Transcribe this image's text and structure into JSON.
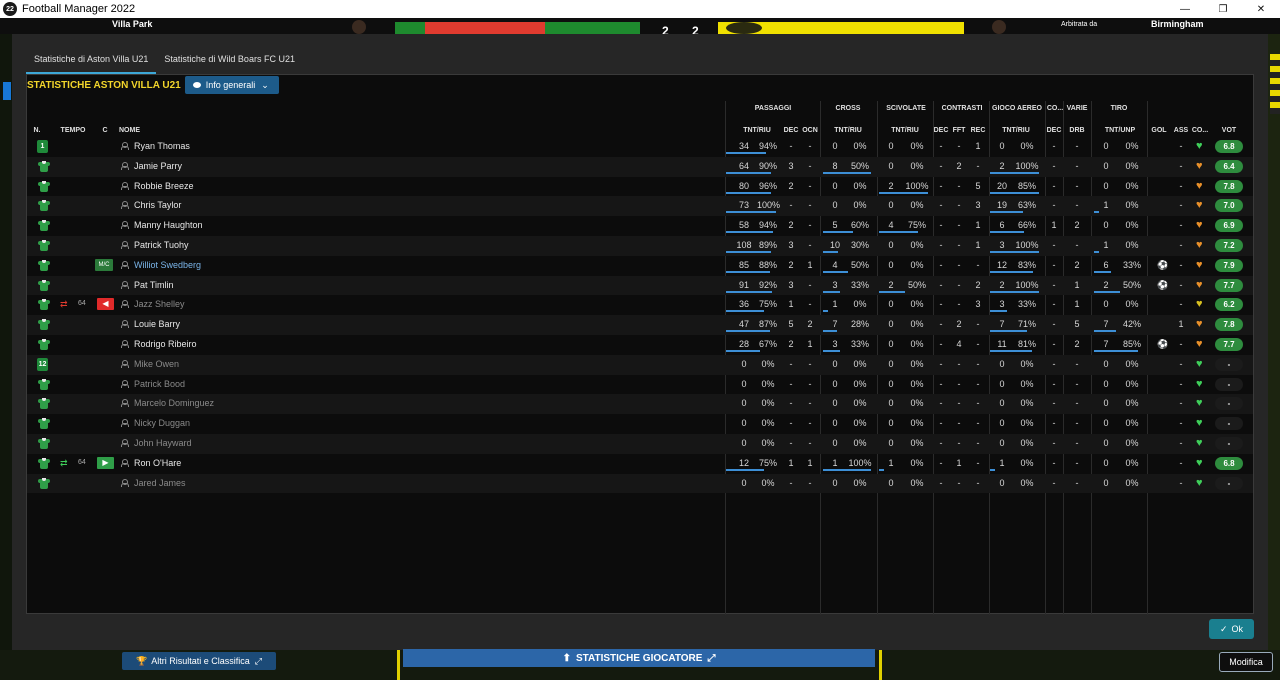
{
  "window": {
    "title": "Football Manager 2022",
    "app_badge": "22",
    "buttons": [
      "—",
      "❐",
      "✕"
    ]
  },
  "background": {
    "venue": "Villa Park",
    "score": "2 2",
    "referee_label": "Arbitrata da",
    "city": "Birmingham"
  },
  "tabs": [
    "Statistiche di Aston Villa U21",
    "Statistiche di Wild Boars FC U21"
  ],
  "panel": {
    "title": "STATISTICHE ASTON VILLA U21",
    "filter_label": "Info generali"
  },
  "groups": {
    "passaggi": "PASSAGGI",
    "cross": "CROSS",
    "scivolate": "SCIVOLATE",
    "contrasti": "CONTRASTI",
    "gioco_aereo": "GIOCO AEREO",
    "co": "CO...",
    "varie": "VARIE",
    "tiro": "TIRO"
  },
  "columns": {
    "n": "N.",
    "tempo": "TEMPO",
    "c": "C",
    "nome": "NOME",
    "pass_tntriu": "TNT/RIU",
    "dec": "DEC",
    "ocn": "OCN",
    "cross_tntriu": "TNT/RIU",
    "sciv_tntriu": "TNT/RIU",
    "contr_dec": "DEC",
    "contr_fft": "FFT",
    "contr_rec": "REC",
    "aereo_tntriu": "TNT/RIU",
    "co_dec": "DEC",
    "drb": "DRB",
    "tiro_tntunp": "TNT/UNP",
    "gol": "GOL",
    "ass": "ASS",
    "cond": "CO...",
    "vot": "VOT"
  },
  "rows": [
    {
      "num": "1",
      "name": "Ryan Thomas",
      "pass": [
        "34",
        "94%"
      ],
      "dec": "-",
      "ocn": "-",
      "cross": [
        "0",
        "0%"
      ],
      "sciv": [
        "0",
        "0%"
      ],
      "cdec": "-",
      "fft": "-",
      "rec": "1",
      "aereo": [
        "0",
        "0%"
      ],
      "adec": "-",
      "drb": "-",
      "tiro": [
        "0",
        "0%"
      ],
      "gol": "",
      "ass": "-",
      "vot": "6.8",
      "heart": "green",
      "pb": [
        0.8,
        0
      ],
      "cb": [
        0,
        0
      ],
      "sb": [
        0,
        0
      ],
      "ab": [
        0,
        0
      ],
      "tb": [
        0,
        0
      ]
    },
    {
      "num": "",
      "name": "Jamie Parry",
      "pass": [
        "64",
        "90%"
      ],
      "dec": "3",
      "ocn": "-",
      "cross": [
        "8",
        "50%"
      ],
      "sciv": [
        "0",
        "0%"
      ],
      "cdec": "-",
      "fft": "2",
      "rec": "-",
      "aereo": [
        "2",
        "100%"
      ],
      "adec": "-",
      "drb": "-",
      "tiro": [
        "0",
        "0%"
      ],
      "gol": "",
      "ass": "-",
      "vot": "6.4",
      "heart": "orange",
      "pb": [
        0.9,
        0
      ],
      "cb": [
        0.95,
        0
      ],
      "sb": [
        0,
        0
      ],
      "ab": [
        0.95,
        0
      ],
      "tb": [
        0,
        0
      ]
    },
    {
      "num": "",
      "name": "Robbie Breeze",
      "pass": [
        "80",
        "96%"
      ],
      "dec": "2",
      "ocn": "-",
      "cross": [
        "0",
        "0%"
      ],
      "sciv": [
        "2",
        "100%"
      ],
      "cdec": "-",
      "fft": "-",
      "rec": "5",
      "aereo": [
        "20",
        "85%"
      ],
      "adec": "-",
      "drb": "-",
      "tiro": [
        "0",
        "0%"
      ],
      "gol": "",
      "ass": "-",
      "vot": "7.8",
      "heart": "orange",
      "pb": [
        0.9,
        0
      ],
      "cb": [
        0,
        0
      ],
      "sb": [
        0.95,
        0
      ],
      "ab": [
        0.95,
        0
      ],
      "tb": [
        0,
        0
      ]
    },
    {
      "num": "",
      "name": "Chris Taylor",
      "pass": [
        "73",
        "100%"
      ],
      "dec": "-",
      "ocn": "-",
      "cross": [
        "0",
        "0%"
      ],
      "sciv": [
        "0",
        "0%"
      ],
      "cdec": "-",
      "fft": "-",
      "rec": "3",
      "aereo": [
        "19",
        "63%"
      ],
      "adec": "-",
      "drb": "-",
      "tiro": [
        "1",
        "0%"
      ],
      "gol": "",
      "ass": "-",
      "vot": "7.0",
      "heart": "orange",
      "pb": [
        1,
        0
      ],
      "cb": [
        0,
        0
      ],
      "sb": [
        0,
        0
      ],
      "ab": [
        0.63,
        0
      ],
      "tb": [
        0.1,
        0
      ]
    },
    {
      "num": "",
      "name": "Manny Haughton",
      "pass": [
        "58",
        "94%"
      ],
      "dec": "2",
      "ocn": "-",
      "cross": [
        "5",
        "60%"
      ],
      "sciv": [
        "4",
        "75%"
      ],
      "cdec": "-",
      "fft": "-",
      "rec": "1",
      "aereo": [
        "6",
        "66%"
      ],
      "adec": "1",
      "drb": "2",
      "tiro": [
        "0",
        "0%"
      ],
      "gol": "",
      "ass": "-",
      "vot": "6.9",
      "heart": "orange",
      "pb": [
        0.94,
        0
      ],
      "cb": [
        0.6,
        0
      ],
      "sb": [
        0.75,
        0
      ],
      "ab": [
        0.66,
        0
      ],
      "tb": [
        0,
        0
      ]
    },
    {
      "num": "",
      "name": "Patrick Tuohy",
      "pass": [
        "108",
        "89%"
      ],
      "dec": "3",
      "ocn": "-",
      "cross": [
        "10",
        "30%"
      ],
      "sciv": [
        "0",
        "0%"
      ],
      "cdec": "-",
      "fft": "-",
      "rec": "1",
      "aereo": [
        "3",
        "100%"
      ],
      "adec": "-",
      "drb": "-",
      "tiro": [
        "1",
        "0%"
      ],
      "gol": "",
      "ass": "-",
      "vot": "7.2",
      "heart": "orange",
      "pb": [
        0.89,
        0
      ],
      "cb": [
        0.3,
        0
      ],
      "sb": [
        0,
        0
      ],
      "ab": [
        0.95,
        0
      ],
      "tb": [
        0.1,
        0
      ]
    },
    {
      "num": "",
      "pos": "M/C",
      "name": "Williot Swedberg",
      "hl": true,
      "pass": [
        "85",
        "88%"
      ],
      "dec": "2",
      "ocn": "1",
      "cross": [
        "4",
        "50%"
      ],
      "sciv": [
        "0",
        "0%"
      ],
      "cdec": "-",
      "fft": "-",
      "rec": "-",
      "aereo": [
        "12",
        "83%"
      ],
      "adec": "-",
      "drb": "2",
      "tiro": [
        "6",
        "33%"
      ],
      "gol": "ball",
      "ass": "-",
      "vot": "7.9",
      "heart": "orange",
      "pb": [
        0.88,
        0
      ],
      "cb": [
        0.5,
        0
      ],
      "sb": [
        0,
        0
      ],
      "ab": [
        0.83,
        0
      ],
      "tb": [
        0.33,
        0
      ]
    },
    {
      "num": "",
      "name": "Pat Timlin",
      "pass": [
        "91",
        "92%"
      ],
      "dec": "3",
      "ocn": "-",
      "cross": [
        "3",
        "33%"
      ],
      "sciv": [
        "2",
        "50%"
      ],
      "cdec": "-",
      "fft": "-",
      "rec": "2",
      "aereo": [
        "2",
        "100%"
      ],
      "adec": "-",
      "drb": "1",
      "tiro": [
        "2",
        "50%"
      ],
      "gol": "ball",
      "ass": "-",
      "vot": "7.7",
      "heart": "orange",
      "pb": [
        0.92,
        0
      ],
      "cb": [
        0.33,
        0
      ],
      "sb": [
        0.5,
        0
      ],
      "ab": [
        0.95,
        0
      ],
      "tb": [
        0.5,
        0
      ]
    },
    {
      "num": "",
      "sub": "off",
      "min": "64",
      "name": "Jazz Shelley",
      "dim": true,
      "pass": [
        "36",
        "75%"
      ],
      "dec": "1",
      "ocn": "-",
      "cross": [
        "1",
        "0%"
      ],
      "sciv": [
        "0",
        "0%"
      ],
      "cdec": "-",
      "fft": "-",
      "rec": "3",
      "aereo": [
        "3",
        "33%"
      ],
      "adec": "-",
      "drb": "1",
      "tiro": [
        "0",
        "0%"
      ],
      "gol": "",
      "ass": "-",
      "vot": "6.2",
      "heart": "yellow",
      "pb": [
        0.75,
        0
      ],
      "cb": [
        0.1,
        0
      ],
      "sb": [
        0,
        0
      ],
      "ab": [
        0.33,
        0
      ],
      "tb": [
        0,
        0
      ]
    },
    {
      "num": "",
      "name": "Louie Barry",
      "pass": [
        "47",
        "87%"
      ],
      "dec": "5",
      "ocn": "2",
      "cross": [
        "7",
        "28%"
      ],
      "sciv": [
        "0",
        "0%"
      ],
      "cdec": "-",
      "fft": "2",
      "rec": "-",
      "aereo": [
        "7",
        "71%"
      ],
      "adec": "-",
      "drb": "5",
      "tiro": [
        "7",
        "42%"
      ],
      "gol": "",
      "ass": "1",
      "vot": "7.8",
      "heart": "orange",
      "pb": [
        0.87,
        0
      ],
      "cb": [
        0.28,
        0
      ],
      "sb": [
        0,
        0
      ],
      "ab": [
        0.71,
        0
      ],
      "tb": [
        0.42,
        0
      ]
    },
    {
      "num": "",
      "name": "Rodrigo Ribeiro",
      "pass": [
        "28",
        "67%"
      ],
      "dec": "2",
      "ocn": "1",
      "cross": [
        "3",
        "33%"
      ],
      "sciv": [
        "0",
        "0%"
      ],
      "cdec": "-",
      "fft": "4",
      "rec": "-",
      "aereo": [
        "11",
        "81%"
      ],
      "adec": "-",
      "drb": "2",
      "tiro": [
        "7",
        "85%"
      ],
      "gol": "ball",
      "ass": "-",
      "vot": "7.7",
      "heart": "orange",
      "pb": [
        0.67,
        0
      ],
      "cb": [
        0.33,
        0
      ],
      "sb": [
        0,
        0
      ],
      "ab": [
        0.81,
        0
      ],
      "tb": [
        0.85,
        0
      ]
    },
    {
      "num": "12",
      "name": "Mike Owen",
      "dim": true,
      "pass": [
        "0",
        "0%"
      ],
      "dec": "-",
      "ocn": "-",
      "cross": [
        "0",
        "0%"
      ],
      "sciv": [
        "0",
        "0%"
      ],
      "cdec": "-",
      "fft": "-",
      "rec": "-",
      "aereo": [
        "0",
        "0%"
      ],
      "adec": "-",
      "drb": "-",
      "tiro": [
        "0",
        "0%"
      ],
      "gol": "",
      "ass": "-",
      "vot": "-",
      "heart": "green",
      "none": true
    },
    {
      "num": "",
      "name": "Patrick Bood",
      "dim": true,
      "pass": [
        "0",
        "0%"
      ],
      "dec": "-",
      "ocn": "-",
      "cross": [
        "0",
        "0%"
      ],
      "sciv": [
        "0",
        "0%"
      ],
      "cdec": "-",
      "fft": "-",
      "rec": "-",
      "aereo": [
        "0",
        "0%"
      ],
      "adec": "-",
      "drb": "-",
      "tiro": [
        "0",
        "0%"
      ],
      "gol": "",
      "ass": "-",
      "vot": "-",
      "heart": "green",
      "none": true
    },
    {
      "num": "",
      "name": "Marcelo Dominguez",
      "dim": true,
      "pass": [
        "0",
        "0%"
      ],
      "dec": "-",
      "ocn": "-",
      "cross": [
        "0",
        "0%"
      ],
      "sciv": [
        "0",
        "0%"
      ],
      "cdec": "-",
      "fft": "-",
      "rec": "-",
      "aereo": [
        "0",
        "0%"
      ],
      "adec": "-",
      "drb": "-",
      "tiro": [
        "0",
        "0%"
      ],
      "gol": "",
      "ass": "-",
      "vot": "-",
      "heart": "green",
      "none": true
    },
    {
      "num": "",
      "name": "Nicky Duggan",
      "dim": true,
      "pass": [
        "0",
        "0%"
      ],
      "dec": "-",
      "ocn": "-",
      "cross": [
        "0",
        "0%"
      ],
      "sciv": [
        "0",
        "0%"
      ],
      "cdec": "-",
      "fft": "-",
      "rec": "-",
      "aereo": [
        "0",
        "0%"
      ],
      "adec": "-",
      "drb": "-",
      "tiro": [
        "0",
        "0%"
      ],
      "gol": "",
      "ass": "-",
      "vot": "-",
      "heart": "green",
      "none": true
    },
    {
      "num": "",
      "name": "John Hayward",
      "dim": true,
      "pass": [
        "0",
        "0%"
      ],
      "dec": "-",
      "ocn": "-",
      "cross": [
        "0",
        "0%"
      ],
      "sciv": [
        "0",
        "0%"
      ],
      "cdec": "-",
      "fft": "-",
      "rec": "-",
      "aereo": [
        "0",
        "0%"
      ],
      "adec": "-",
      "drb": "-",
      "tiro": [
        "0",
        "0%"
      ],
      "gol": "",
      "ass": "-",
      "vot": "-",
      "heart": "green",
      "none": true
    },
    {
      "num": "",
      "sub": "on",
      "min": "64",
      "name": "Ron O'Hare",
      "pass": [
        "12",
        "75%"
      ],
      "dec": "1",
      "ocn": "1",
      "cross": [
        "1",
        "100%"
      ],
      "sciv": [
        "1",
        "0%"
      ],
      "cdec": "-",
      "fft": "1",
      "rec": "-",
      "aereo": [
        "1",
        "0%"
      ],
      "adec": "-",
      "drb": "-",
      "tiro": [
        "0",
        "0%"
      ],
      "gol": "",
      "ass": "-",
      "vot": "6.8",
      "heart": "green",
      "pb": [
        0.75,
        0
      ],
      "cb": [
        0.95,
        0
      ],
      "sb": [
        0.1,
        0
      ],
      "ab": [
        0.1,
        0
      ],
      "tb": [
        0,
        0
      ]
    },
    {
      "num": "",
      "name": "Jared James",
      "dim": true,
      "pass": [
        "0",
        "0%"
      ],
      "dec": "-",
      "ocn": "-",
      "cross": [
        "0",
        "0%"
      ],
      "sciv": [
        "0",
        "0%"
      ],
      "cdec": "-",
      "fft": "-",
      "rec": "-",
      "aereo": [
        "0",
        "0%"
      ],
      "adec": "-",
      "drb": "-",
      "tiro": [
        "0",
        "0%"
      ],
      "gol": "",
      "ass": "-",
      "vot": "-",
      "heart": "green",
      "none": true
    }
  ],
  "colors": {
    "accent": "#3d8fd6",
    "title": "#f2d52b",
    "heart_green": "#3fcf5a",
    "heart_orange": "#e8902a",
    "heart_yellow": "#d8c020",
    "rating_green": "#2e8c3e"
  },
  "footer": {
    "ok": "Ok",
    "results": "Altri Risultati e Classifica",
    "player_stats": "STATISTICHE GIOCATORE",
    "edit": "Modifica"
  }
}
